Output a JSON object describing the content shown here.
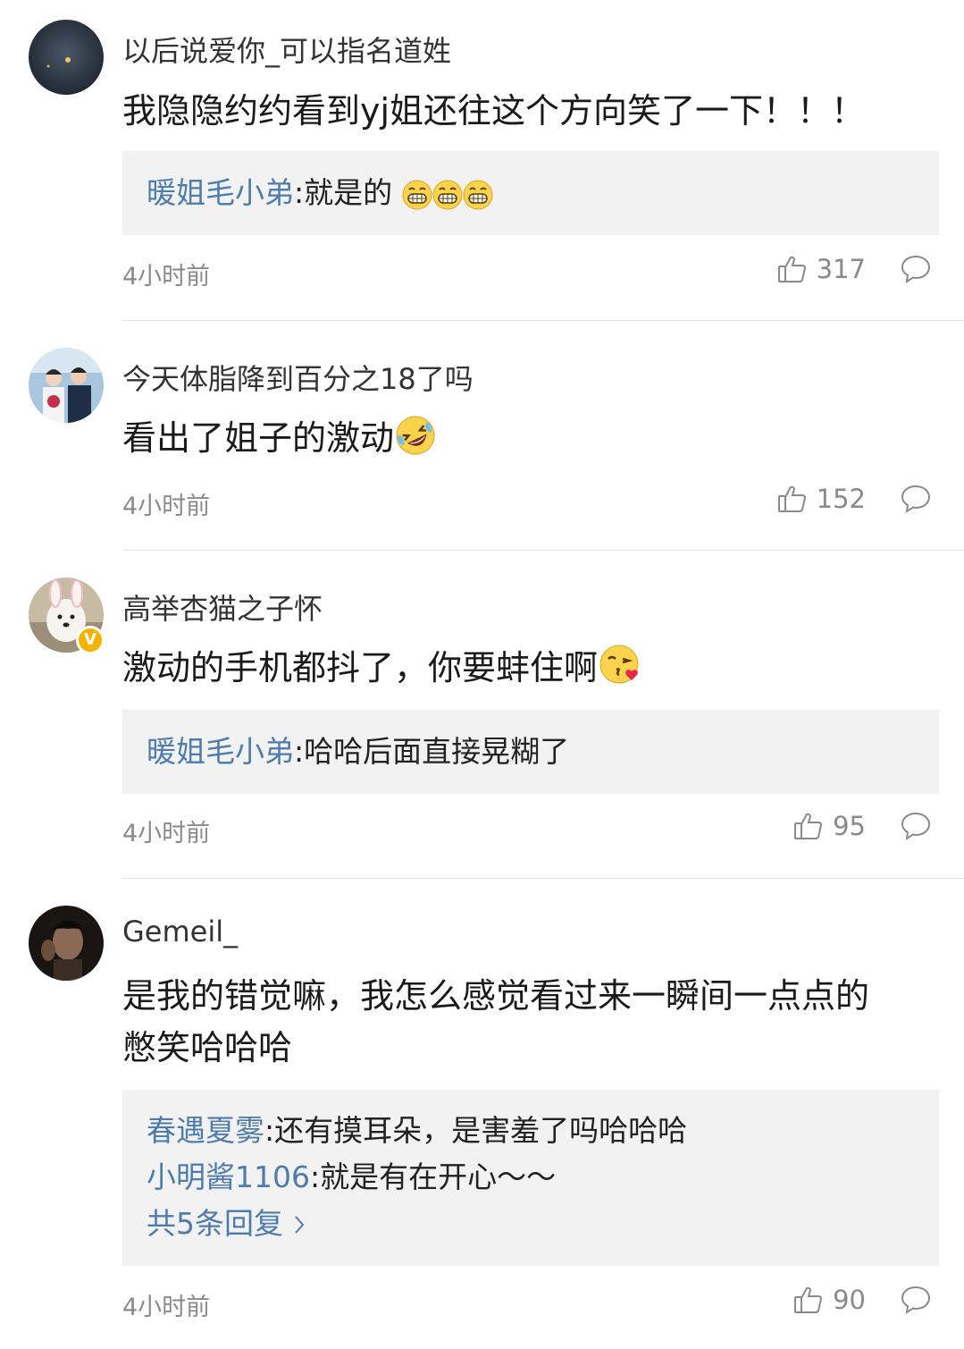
{
  "comments": [
    {
      "username": "以后说爱你_可以指名道姓",
      "text": "我隐隐约约看到yj姐还往这个方向笑了一下！！！",
      "replies": [
        {
          "user": "暖姐毛小弟",
          "text": ":就是的"
        }
      ],
      "time": "4小时前",
      "likes": "317"
    },
    {
      "username": "今天体脂降到百分之18了吗",
      "text": "看出了姐子的激动",
      "time": "4小时前",
      "likes": "152"
    },
    {
      "username": "高举杏猫之子怀",
      "text": "激动的手机都抖了，你要蚌住啊",
      "replies": [
        {
          "user": "暖姐毛小弟",
          "text": ":哈哈后面直接晃糊了"
        }
      ],
      "time": "4小时前",
      "likes": "95",
      "verified_badge": "V"
    },
    {
      "username": "Gemeil_",
      "text_lines": [
        "是我的错觉嘛，我怎么感觉看过来一瞬间一点点的",
        "憋笑哈哈哈"
      ],
      "replies": [
        {
          "user": "春遇夏雾",
          "text": ":还有摸耳朵，是害羞了吗哈哈哈"
        },
        {
          "user": "小明酱1106",
          "text": ":就是有在开心～～"
        }
      ],
      "more_replies": "共5条回复",
      "time": "4小时前",
      "likes": "90"
    }
  ],
  "icons": {
    "like": "thumbs-up-icon",
    "reply": "comment-bubble-icon",
    "emoji_grin": "grinning-emoji",
    "emoji_laugh": "rolling-laughing-emoji",
    "emoji_kiss": "kissing-heart-emoji",
    "chevron": "chevron-right-icon"
  },
  "colors": {
    "link": "#4e7cad",
    "reply_bg": "#f2f2f2",
    "meta": "#8a8a8a",
    "badge": "#f5b400"
  }
}
